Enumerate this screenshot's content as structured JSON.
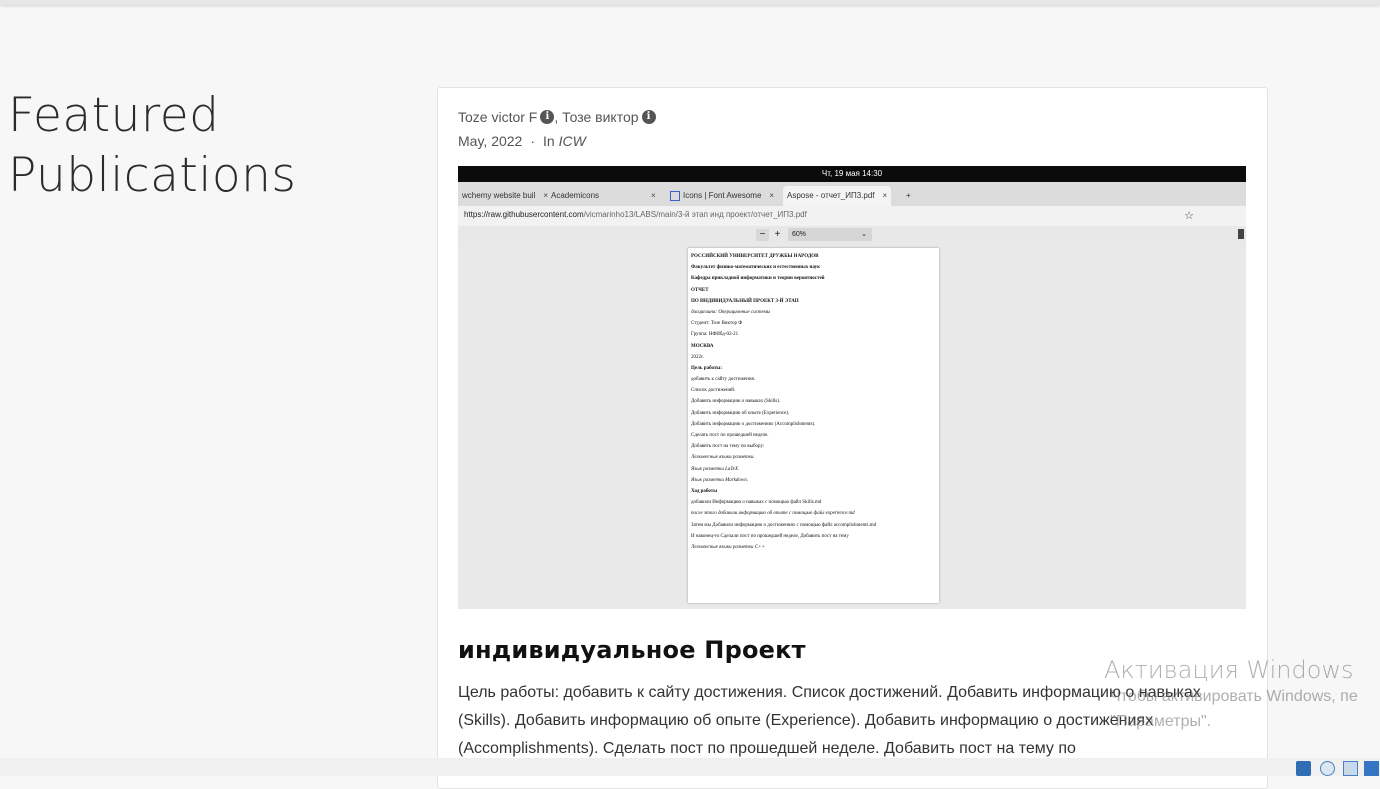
{
  "section": {
    "title_line1": "Featured",
    "title_line2": "Publications"
  },
  "publication": {
    "author1": "Toze victor F",
    "separator": ",",
    "author2": "Тозе виктор",
    "date": "May, 2022",
    "dot": "·",
    "in_label": "In",
    "venue": "ICW",
    "title": "индивидуальное Проект",
    "summary": "Цель работы: добавить к сайту достижения. Список достижений. Добавить информацию о навыках (Skills). Добавить информацию об опыте (Experience). Добавить информацию о достижениях (Accomplishments). Сделать пост по прошедшей неделе. Добавить пост на тему по"
  },
  "featured_image": {
    "clock": "Чт, 19 мая  14:30",
    "tabs": [
      {
        "label": "wchemy website buil",
        "close": "×"
      },
      {
        "label": "Academicons",
        "close": "×"
      },
      {
        "label": "Icons | Font Awesome",
        "close": "×"
      },
      {
        "label": "Aspose - отчет_ИП3.pdf",
        "close": "×"
      }
    ],
    "new_tab": "+",
    "url_host": "https://raw.githubusercontent.com",
    "url_path": "/vicmarinho13/LABS/main/3-й этап инд проект/отчет_ИП3.pdf",
    "zoom_minus": "−",
    "zoom_plus": "+",
    "zoom": "60%",
    "zoom_chevron": "⌄",
    "pdf_lines": [
      {
        "t": "РОССИЙСКИЙ УНИВЕРСИТЕТ ДРУЖБЫ НАРОДОВ",
        "s": "b"
      },
      {
        "t": "Факультет физико-математических и естественных наук",
        "s": "b"
      },
      {
        "t": "Кафедра прикладной информатики и теории вероятностей",
        "s": "b"
      },
      {
        "t": "ОТЧЕТ",
        "s": "b"
      },
      {
        "t": "ПО ИНДИВИДУАЛЬНЫЙ ПРОЕКТ 3-Й ЭТАП",
        "s": "b"
      },
      {
        "t": "дисциплина: Операционные системы",
        "s": "i"
      },
      {
        "t": "Студент: Тозе Виктор Ф",
        "s": ""
      },
      {
        "t": "Группа: НФИбд-02-21",
        "s": ""
      },
      {
        "t": "МОСКВА",
        "s": "b"
      },
      {
        "t": "2022г.",
        "s": ""
      },
      {
        "t": "Цель работы:",
        "s": "b"
      },
      {
        "t": "добавить к сайту достижения.",
        "s": ""
      },
      {
        "t": "Список достижений.",
        "s": ""
      },
      {
        "t": "Добавить информацию о навыках (Skills).",
        "s": ""
      },
      {
        "t": "Добавить информацию об опыте (Experience).",
        "s": ""
      },
      {
        "t": "Добавить информацию о достижениях (Accomplishments).",
        "s": ""
      },
      {
        "t": "Сделать пост по прошедшей неделе.",
        "s": ""
      },
      {
        "t": "Добавить пост на тему по выбору:",
        "s": ""
      },
      {
        "t": "Легковесные языки разметки.",
        "s": "i"
      },
      {
        "t": "Язык разметки LaTeX.",
        "s": "i"
      },
      {
        "t": "Язык разметки Markdown.",
        "s": "i"
      },
      {
        "t": "Ход работы",
        "s": "b"
      },
      {
        "t": "добавили Информацию о навыках с помощью файл Skills.md",
        "s": ""
      },
      {
        "t": "после этого добавили информацию об опыте с помощью файл experience.md",
        "s": "i"
      },
      {
        "t": "Затем мы Добавили информацию о достижениях с помощью файл accomplishments.md",
        "s": ""
      },
      {
        "t": "И наконец-то Сделали пост по прошедшей неделе, Добавить пост на тему",
        "s": ""
      },
      {
        "t": "Легковесные языки разметки C++",
        "s": "i"
      }
    ]
  },
  "watermark": {
    "title": "Активация Windows",
    "line1": "Чтобы активировать Windows, пе",
    "line2": "\"Параметры\"."
  }
}
